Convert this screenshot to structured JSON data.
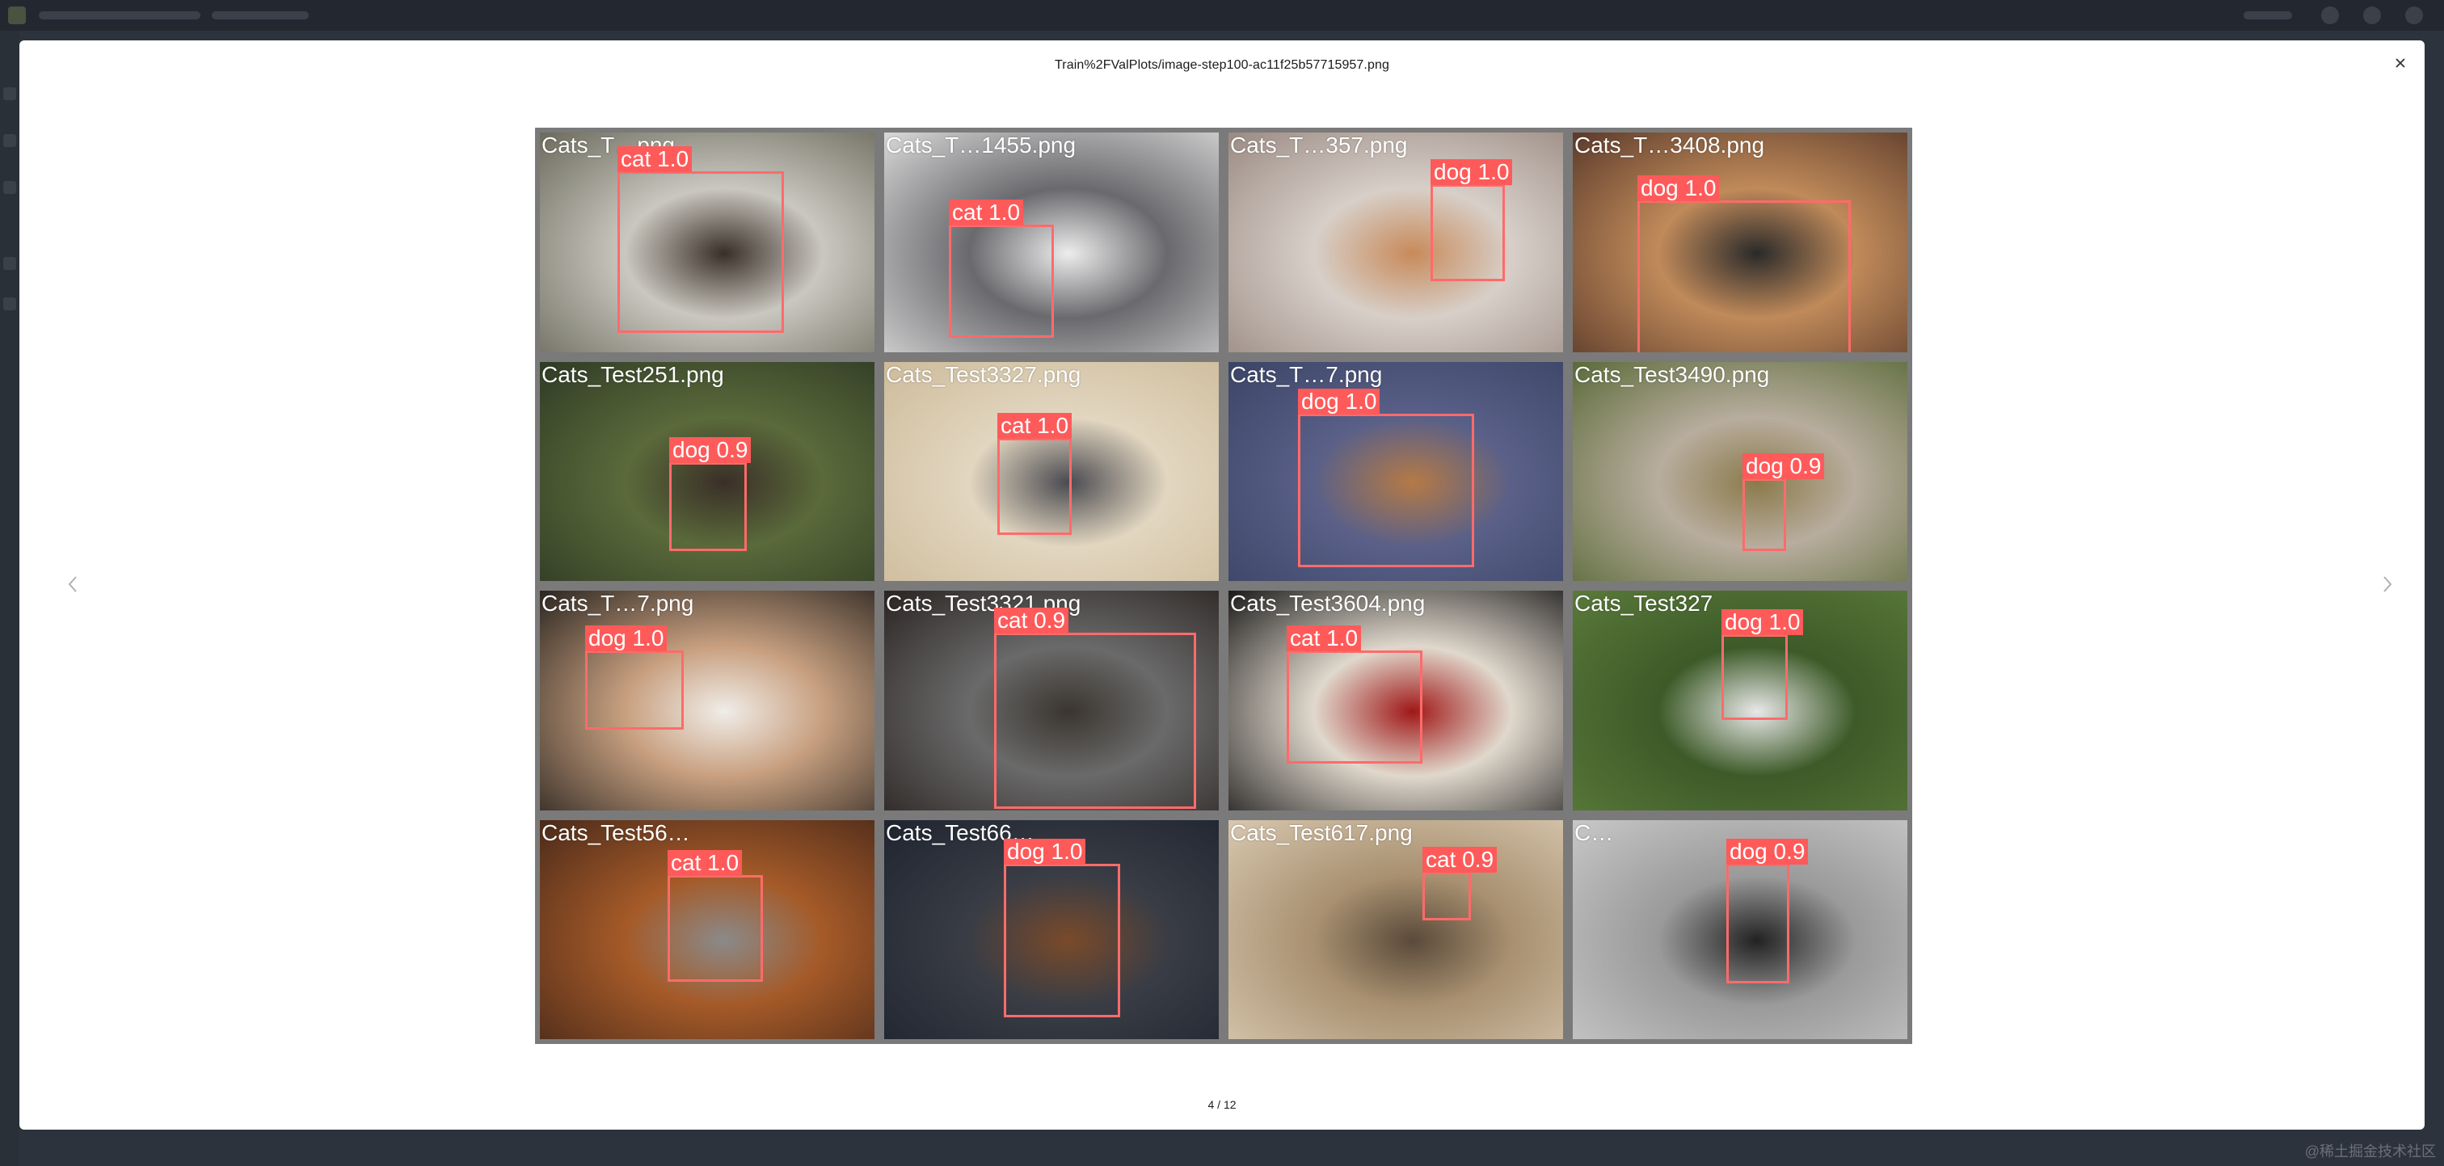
{
  "modal": {
    "title": "Train%2FValPlots/image-step100-ac11f25b57715957.png",
    "counter": "4 / 12",
    "close_icon": "close-icon",
    "prev_icon": "chevron-left-icon",
    "next_icon": "chevron-right-icon"
  },
  "watermark": "@稀土掘金技术社区",
  "tiles": [
    {
      "label": "Cats_T…png",
      "box": {
        "label": "cat 1.0"
      },
      "colors": [
        "#6b6a5c",
        "#c9c7bf",
        "#3a2f28"
      ]
    },
    {
      "label": "Cats_T…1455.png",
      "box": {
        "label": "cat 1.0"
      },
      "colors": [
        "#d9d9d9",
        "#6a6a6e",
        "#ededed"
      ]
    },
    {
      "label": "Cats_T…357.png",
      "box": {
        "label": "dog 1.0"
      },
      "colors": [
        "#9a8a83",
        "#d7cfc8",
        "#c88a5a"
      ]
    },
    {
      "label": "Cats_T…3408.png",
      "box": {
        "label": "dog 1.0"
      },
      "colors": [
        "#5a3a2a",
        "#c08a5a",
        "#2a2a2a"
      ]
    },
    {
      "label": "Cats_Test251.png",
      "box": {
        "label": "dog 0.9"
      },
      "colors": [
        "#2f3a25",
        "#5a6a3a",
        "#3a2f28"
      ]
    },
    {
      "label": "Cats_Test3327.png",
      "box": {
        "label": "cat 1.0"
      },
      "colors": [
        "#cdbb9a",
        "#e2d6c0",
        "#4a4a50"
      ]
    },
    {
      "label": "Cats_T…7.png",
      "box": {
        "label": "dog 1.0"
      },
      "colors": [
        "#3b4466",
        "#5a6088",
        "#b57a45"
      ]
    },
    {
      "label": "Cats_Test3490.png",
      "box": {
        "label": "dog 0.9"
      },
      "colors": [
        "#5a6a38",
        "#b8ad9e",
        "#8a7a4a"
      ]
    },
    {
      "label": "Cats_T…7.png",
      "box": {
        "label": "dog 1.0"
      },
      "colors": [
        "#2a2520",
        "#c8a080",
        "#f0ede8"
      ]
    },
    {
      "label": "Cats_Test3321.png",
      "box": {
        "label": "cat 0.9"
      },
      "colors": [
        "#2a2422",
        "#6a6a6a",
        "#3a3530"
      ]
    },
    {
      "label": "Cats_Test3604.png",
      "box": {
        "label": "cat 1.0"
      },
      "colors": [
        "#1a1a1a",
        "#e0d8cc",
        "#a01818"
      ]
    },
    {
      "label": "Cats_Test327",
      "box": {
        "label": "dog 1.0"
      },
      "colors": [
        "#5a7a3a",
        "#3d5a28",
        "#e8e8e8"
      ]
    },
    {
      "label": "Cats_Test56…",
      "box": {
        "label": "cat 1.0"
      },
      "colors": [
        "#4a2a1a",
        "#a55a28",
        "#8a8a8a"
      ]
    },
    {
      "label": "Cats_Test66…",
      "box": {
        "label": "dog 1.0"
      },
      "colors": [
        "#1f2430",
        "#3a3d45",
        "#7a4a2a"
      ]
    },
    {
      "label": "Cats_Test617.png",
      "box": {
        "label": "cat 0.9"
      },
      "colors": [
        "#d8c8b0",
        "#a89070",
        "#5a4a3a"
      ]
    },
    {
      "label": "C…",
      "box": {
        "label": "dog 0.9"
      },
      "colors": [
        "#c8c8c8",
        "#9a9a9a",
        "#222222"
      ]
    }
  ]
}
